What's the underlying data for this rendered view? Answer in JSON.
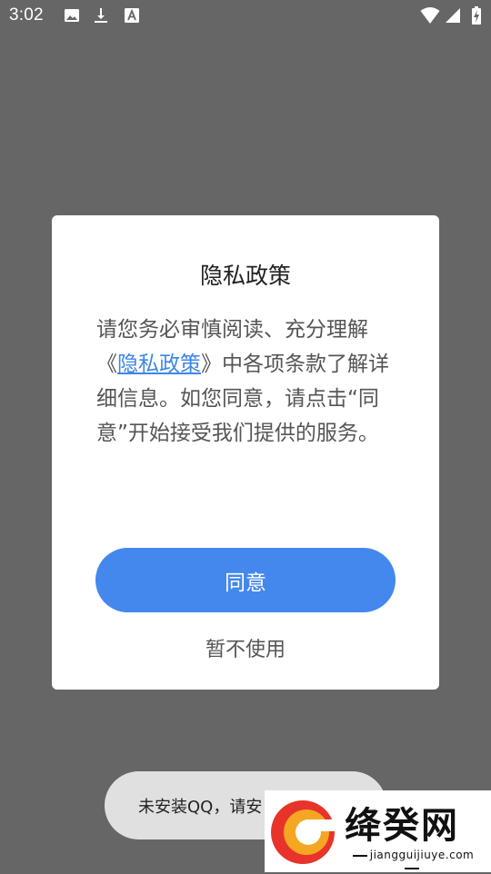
{
  "status_bar": {
    "time": "3:02",
    "left_icons": [
      "image-icon",
      "download-icon",
      "text-box-icon"
    ],
    "right_icons": [
      "wifi-icon",
      "signal-icon",
      "battery-charging-icon"
    ]
  },
  "dialog": {
    "title": "隐私政策",
    "body": {
      "before_link": "请您务必审慎阅读、充分理解《",
      "link": "隐私政策",
      "after_link": "》中各项条款了解详细信息。如您同意，请点击“同意”开始接受我们提供的服务。"
    },
    "agree_label": "同意",
    "decline_label": "暂不使用",
    "accent_color": "#4488ee"
  },
  "toast": {
    "text": "未安装QQ，请安"
  },
  "watermark": {
    "name": "绛癸网",
    "domain": "jiangguijiuye.com",
    "logo_colors": [
      "#e8332a",
      "#f5a623"
    ]
  }
}
